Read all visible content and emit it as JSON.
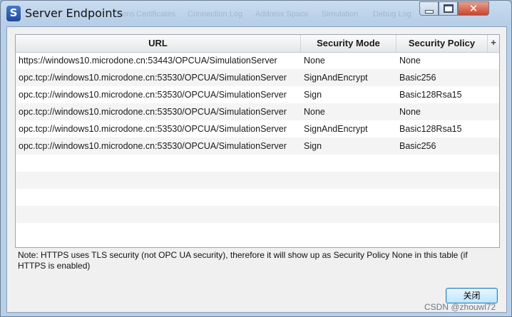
{
  "window": {
    "title": "Server Endpoints",
    "icon_letter": "S",
    "ghost_tabs": [
      "ons",
      "Certificates",
      "Connection Log",
      "Address Space",
      "Simulation",
      "Debug Log"
    ]
  },
  "table": {
    "columns": [
      "URL",
      "Security Mode",
      "Security Policy"
    ],
    "add_column_label": "+",
    "rows": [
      {
        "url": "https://windows10.microdone.cn:53443/OPCUA/SimulationServer",
        "mode": "None",
        "policy": "None"
      },
      {
        "url": "opc.tcp://windows10.microdone.cn:53530/OPCUA/SimulationServer",
        "mode": "SignAndEncrypt",
        "policy": "Basic256"
      },
      {
        "url": "opc.tcp://windows10.microdone.cn:53530/OPCUA/SimulationServer",
        "mode": "Sign",
        "policy": "Basic128Rsa15"
      },
      {
        "url": "opc.tcp://windows10.microdone.cn:53530/OPCUA/SimulationServer",
        "mode": "None",
        "policy": "None"
      },
      {
        "url": "opc.tcp://windows10.microdone.cn:53530/OPCUA/SimulationServer",
        "mode": "SignAndEncrypt",
        "policy": "Basic128Rsa15"
      },
      {
        "url": "opc.tcp://windows10.microdone.cn:53530/OPCUA/SimulationServer",
        "mode": "Sign",
        "policy": "Basic256"
      }
    ]
  },
  "note": "Note: HTTPS uses TLS security (not OPC UA security), therefore it will show up as Security Policy None in this table (if HTTPS is enabled)",
  "buttons": {
    "close_label": "关闭"
  },
  "watermark": "CSDN @zhouwl72",
  "colors": {
    "close_button_bg": "#c9432b",
    "title_bar": "#b8cfe8",
    "dialog_bg": "#f0f0f0"
  }
}
